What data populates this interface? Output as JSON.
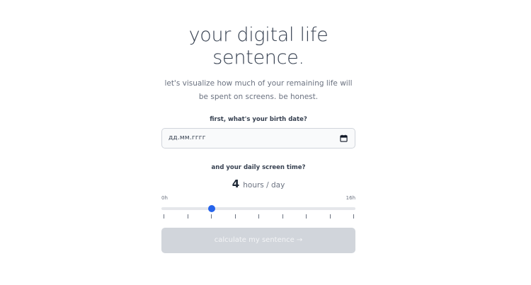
{
  "header": {
    "title": "your digital life sentence.",
    "subtitle": "let's visualize how much of your remaining life will be spent on screens. be honest."
  },
  "birth_date": {
    "label": "first, what's your birth date?",
    "placeholder": "дд.мм.гггг",
    "icon": "calendar-icon"
  },
  "screen_time": {
    "label": "and your daily screen time?",
    "value": "4",
    "unit": "hours / day",
    "min_label": "0h",
    "max_label": "16h",
    "min": 0,
    "max": 16,
    "current": 4,
    "tick_count": 9
  },
  "action": {
    "calculate_label": "calculate my sentence →"
  },
  "colors": {
    "accent": "#2563eb",
    "button_disabled": "#d1d5db",
    "track": "#e5e7eb"
  }
}
